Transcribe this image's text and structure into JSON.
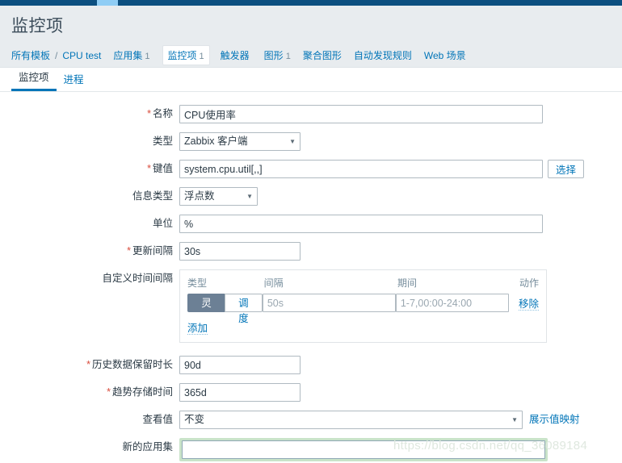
{
  "topbar": {
    "accent_dark": "#0c4f80",
    "accent_light": "#8fcdf5"
  },
  "header": {
    "title": "监控项"
  },
  "breadcrumb": {
    "root_label": "所有模板",
    "separator": "/",
    "host_label": "CPU test",
    "items": [
      {
        "label": "应用集",
        "count": "1",
        "active": false
      },
      {
        "label": "监控项",
        "count": "1",
        "active": true
      },
      {
        "label": "触发器",
        "count": "",
        "active": false
      },
      {
        "label": "图形",
        "count": "1",
        "active": false
      },
      {
        "label": "聚合图形",
        "count": "",
        "active": false
      },
      {
        "label": "自动发现规则",
        "count": "",
        "active": false
      },
      {
        "label": "Web 场景",
        "count": "",
        "active": false
      }
    ]
  },
  "tabs": [
    {
      "label": "监控项",
      "active": true
    },
    {
      "label": "进程",
      "active": false
    }
  ],
  "form": {
    "name": {
      "label": "名称",
      "required": true,
      "value": "CPU使用率"
    },
    "type": {
      "label": "类型",
      "required": false,
      "value": "Zabbix 客户端"
    },
    "key": {
      "label": "键值",
      "required": true,
      "value": "system.cpu.util[,,]",
      "button": "选择"
    },
    "info_type": {
      "label": "信息类型",
      "required": false,
      "value": "浮点数"
    },
    "units": {
      "label": "单位",
      "required": false,
      "value": "%"
    },
    "update_interval": {
      "label": "更新间隔",
      "required": true,
      "value": "30s"
    },
    "custom_intervals": {
      "label": "自定义时间间隔",
      "columns": [
        "类型",
        "间隔",
        "期间",
        "动作"
      ],
      "rows": [
        {
          "type_flexible": "灵活",
          "type_scheduling": "调度",
          "type_selected": "灵活",
          "delay_value": "",
          "delay_placeholder": "50s",
          "period_value": "",
          "period_placeholder": "1-7,00:00-24:00",
          "action": "移除"
        }
      ],
      "add_label": "添加"
    },
    "history": {
      "label": "历史数据保留时长",
      "required": true,
      "value": "90d"
    },
    "trends": {
      "label": "趋势存储时间",
      "required": true,
      "value": "365d"
    },
    "value_mapping": {
      "label": "查看值",
      "required": false,
      "value": "不变",
      "link": "展示值映射"
    },
    "new_application": {
      "label": "新的应用集",
      "required": false,
      "value": "",
      "focused": true
    }
  },
  "watermark": {
    "text": "https://blog.csdn.net/qq_36089184"
  }
}
